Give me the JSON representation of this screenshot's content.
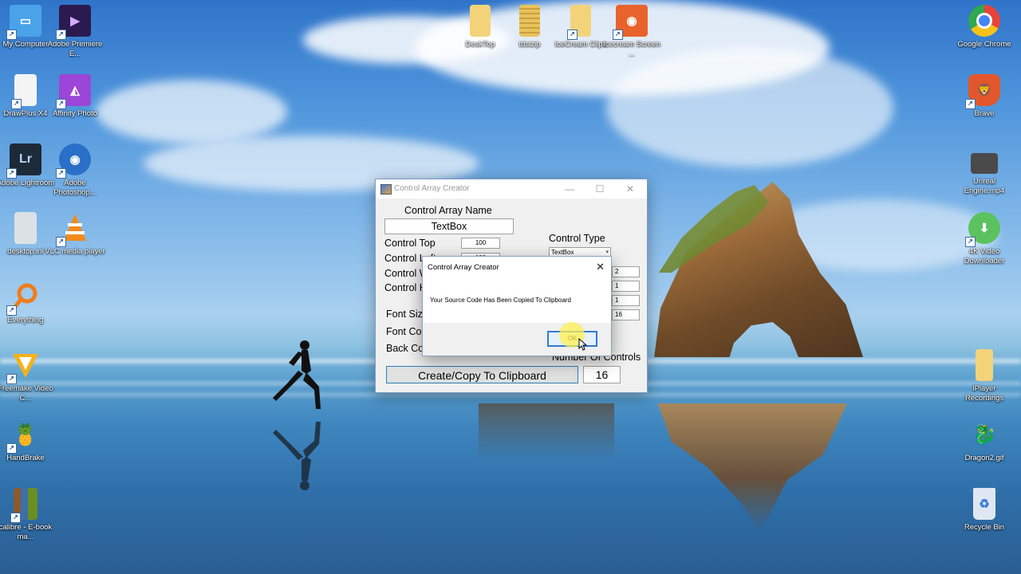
{
  "desktop": {
    "icons_left": [
      {
        "label": "My Computer",
        "icon": "computer-icon",
        "color": "#4aa3e8"
      },
      {
        "label": "Adobe Premiere E...",
        "icon": "premiere-icon",
        "color": "#2b1a4f"
      },
      {
        "label": "DrawPlus X4",
        "icon": "document-icon",
        "color": "#f4f4f4"
      },
      {
        "label": "Affinity Photo",
        "icon": "affinity-icon",
        "color": "#9b46d8"
      },
      {
        "label": "Adobe Lightroom",
        "icon": "lightroom-icon",
        "color": "#1d2a38"
      },
      {
        "label": "Adobe Photoshop...",
        "icon": "camera-icon",
        "color": "#2a70c8"
      },
      {
        "label": "desktop.ini",
        "icon": "settings-file-icon",
        "color": "#e6e6e6"
      },
      {
        "label": "VLC media player",
        "icon": "vlc-icon",
        "color": "#f28a1a"
      },
      {
        "label": "Everything",
        "icon": "search-icon",
        "color": "#f07d1a"
      },
      {
        "label": "Freemake Video C...",
        "icon": "freemake-icon",
        "color": "#f2b21a"
      },
      {
        "label": "HandBrake",
        "icon": "handbrake-icon",
        "color": "#d9a32c"
      },
      {
        "label": "calibre - E-book ma...",
        "icon": "books-icon",
        "color": "#8b5a2b"
      }
    ],
    "icons_top": [
      {
        "label": "DeskTop",
        "icon": "folder-icon",
        "color": "#f3d37a"
      },
      {
        "label": "tdsizip",
        "icon": "zip-folder-icon",
        "color": "#e9c35a"
      },
      {
        "label": "IceCream Clips",
        "icon": "folder-icon",
        "color": "#f3d37a"
      },
      {
        "label": "Icecream Screen ...",
        "icon": "icecream-icon",
        "color": "#e8632b"
      }
    ],
    "icons_right": [
      {
        "label": "Google Chrome",
        "icon": "chrome-icon",
        "color": "#e7443a"
      },
      {
        "label": "Brave",
        "icon": "brave-icon",
        "color": "#e4562c"
      },
      {
        "label": "Unreal Engine.mp4",
        "icon": "video-file-icon",
        "color": "#4a4a4a"
      },
      {
        "label": "4K Video Downloader",
        "icon": "download-icon",
        "color": "#5cc25f"
      },
      {
        "label": "iPlayer Recordings",
        "icon": "folder-icon",
        "color": "#f3d37a"
      },
      {
        "label": "Dragon2.gif",
        "icon": "dragon-icon",
        "color": "#d02020"
      },
      {
        "label": "Recycle Bin",
        "icon": "recycle-bin-icon",
        "color": "#dfe8f2"
      }
    ]
  },
  "window": {
    "title": "Control Array Creator",
    "array_name_label": "Control Array Name",
    "array_name_value": "TextBox",
    "control_top_label": "Control Top",
    "control_top_value": "100",
    "control_left_label": "Control Left",
    "control_left_value": "100",
    "control_width_label": "Control Width",
    "control_height_label": "Control Height",
    "control_type_label": "Control Type",
    "control_type_value": "TextBox",
    "right_values": [
      "2",
      "1",
      "1",
      "16"
    ],
    "font_size_label": "Font Size",
    "font_color_label": "Font Color",
    "back_color_label": "Back Color",
    "number_of_controls_label": "Number Of Controls",
    "create_button": "Create/Copy To Clipboard",
    "number_of_controls_value": "16"
  },
  "messagebox": {
    "title": "Control Array Creator",
    "text": "Your Source Code Has Been Copied To Clipboard",
    "ok": "OK",
    "close": "✕"
  },
  "titlebar_buttons": {
    "minimize": "—",
    "maximize": "☐",
    "close": "✕"
  }
}
